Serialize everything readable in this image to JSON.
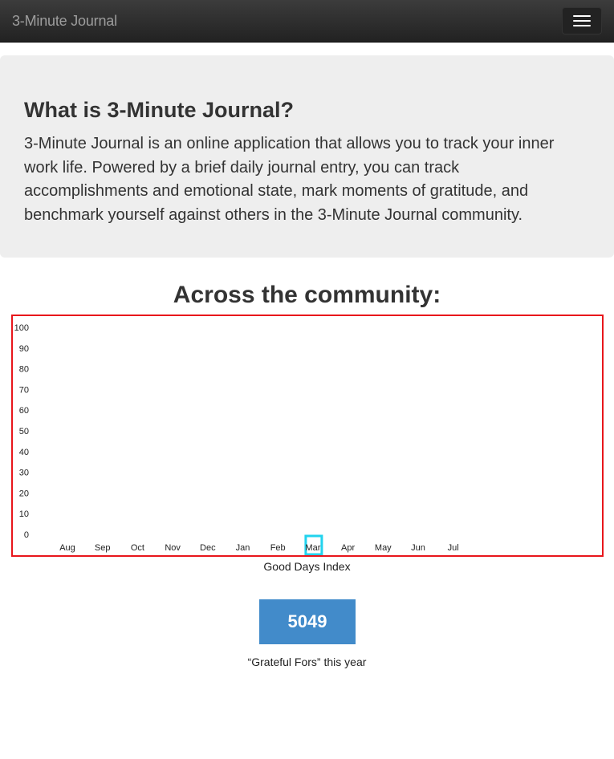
{
  "navbar": {
    "brand": "3-Minute Journal",
    "menu_icon": "hamburger-menu-icon"
  },
  "jumbotron": {
    "title": "What is 3-Minute Journal?",
    "description": "3-Minute Journal is an online application that allows you to track your inner work life. Powered by a brief daily journal entry, you can track accomplishments and emotional state, mark moments of gratitude, and benchmark yourself against others in the 3-Minute Journal community."
  },
  "community": {
    "heading": "Across the community:",
    "chart_caption": "Good Days Index",
    "stat_value": "5049",
    "stat_caption": "“Grateful Fors” this year"
  },
  "colors": {
    "chart_border": "#e8161b",
    "highlight": "#22d3ee",
    "stat_button": "#428bca"
  },
  "chart_data": {
    "type": "bar",
    "categories": [
      "Aug",
      "Sep",
      "Oct",
      "Nov",
      "Dec",
      "Jan",
      "Feb",
      "Mar",
      "Apr",
      "May",
      "Jun",
      "Jul"
    ],
    "yticks": [
      "0",
      "10",
      "20",
      "30",
      "40",
      "50",
      "60",
      "70",
      "80",
      "90",
      "100"
    ],
    "ylim": [
      0,
      100
    ],
    "series": [],
    "highlighted_category": "Mar",
    "grid": false,
    "title": "",
    "xlabel": "",
    "ylabel": ""
  }
}
